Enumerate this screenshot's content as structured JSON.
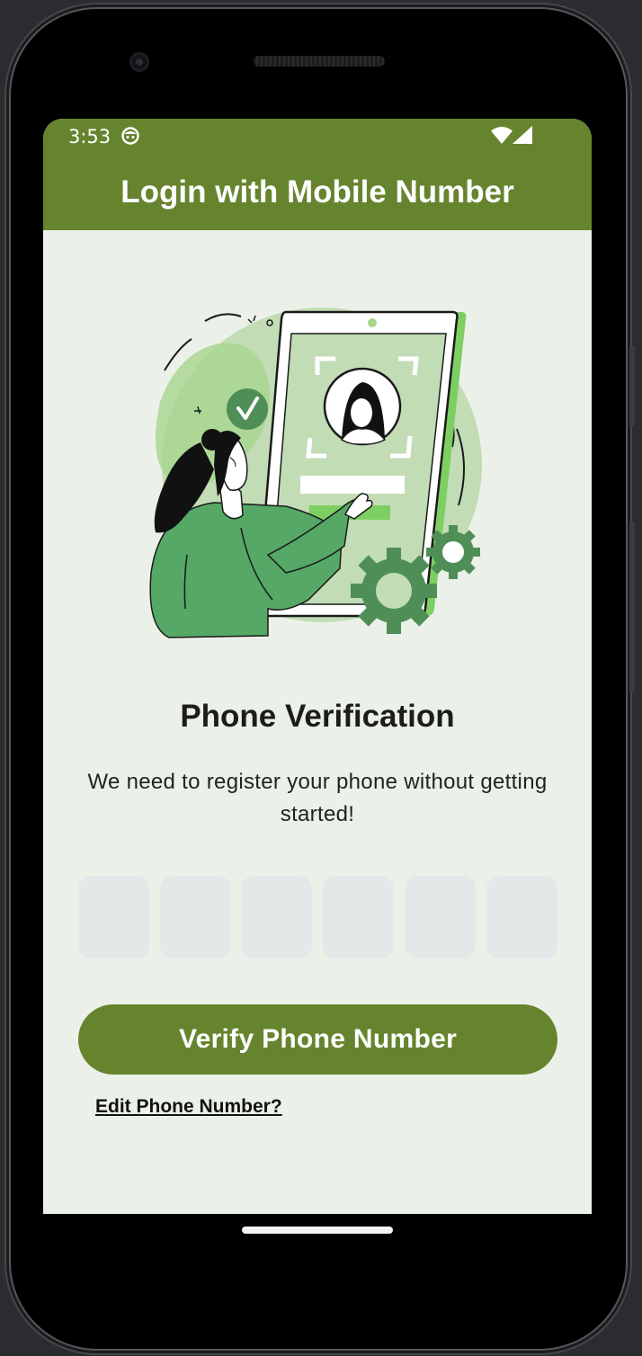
{
  "status_bar": {
    "time": "3:53",
    "icons": [
      "face-icon",
      "wifi-icon",
      "cell-signal-icon"
    ]
  },
  "app_bar": {
    "title": "Login with Mobile Number"
  },
  "illustration": {
    "icon": "phone-verification-illustration"
  },
  "main": {
    "headline": "Phone Verification",
    "subtext": "We need to register your phone without getting started!",
    "otp": {
      "digits": [
        "",
        "",
        "",
        "",
        "",
        ""
      ]
    },
    "verify_button_label": "Verify Phone Number",
    "edit_link_label": "Edit Phone Number?"
  },
  "colors": {
    "primary": "#66842e",
    "background": "#ebf1e8",
    "otp_box": "#e3e9e9",
    "illustration_green": "#55a865"
  }
}
